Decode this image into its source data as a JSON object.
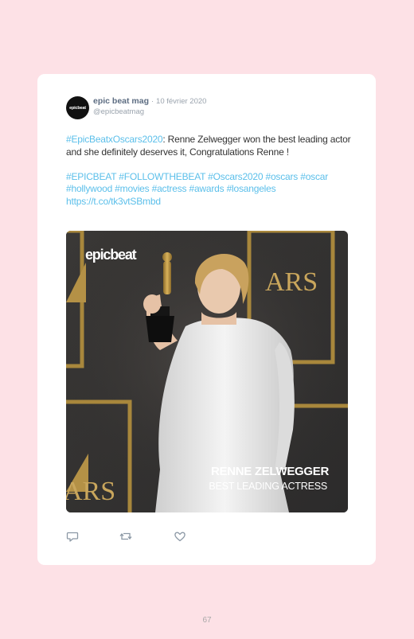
{
  "tweet": {
    "author": {
      "name": "epic beat mag",
      "handle": "@epicbeatmag",
      "avatar_text": "epicbeat"
    },
    "separator": "·",
    "date": "10 février 2020",
    "text": {
      "hashtag_lead": "#EpicBeatxOscars2020",
      "body": ": Renne Zelwegger won the best leading actor and she definitely deserves it, Congratulations Renne !",
      "hashtags": "#EPICBEAT #FOLLOWTHEBEAT #Oscars2020 #oscars #oscar #hollywood #movies #actress #awards #losangeles",
      "link": "https://t.co/tk3vtSBmbd"
    },
    "media": {
      "logo": "epicbeat",
      "caption_name": "RENNE ZELWEGGER",
      "caption_title": "BEST LEADING ACTRESS",
      "backdrop_text_top": "ARS",
      "backdrop_text_bottom": "ARS"
    },
    "actions": [
      "reply-icon",
      "retweet-icon",
      "like-icon"
    ]
  },
  "page_number": "67",
  "colors": {
    "background": "#fde1e6",
    "card": "#ffffff",
    "link": "#5bbfea",
    "name": "#5d6d82",
    "muted": "#9aa3ad"
  }
}
